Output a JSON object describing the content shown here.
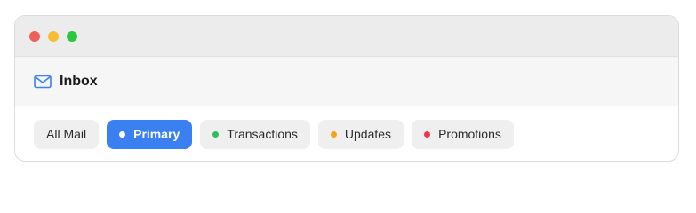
{
  "window": {
    "controls": [
      {
        "name": "close-control",
        "color": "#ee5f57"
      },
      {
        "name": "minimize-control",
        "color": "#f5bd2f"
      },
      {
        "name": "maximize-control",
        "color": "#2ec840"
      }
    ]
  },
  "header": {
    "icon": "mail-icon",
    "title": "Inbox",
    "accent": "#3a80f0"
  },
  "tabs": [
    {
      "label": "All Mail",
      "dot_color": null,
      "active": false
    },
    {
      "label": "Primary",
      "dot_color": "#ffffff",
      "active": true
    },
    {
      "label": "Transactions",
      "dot_color": "#2cc05a",
      "active": false
    },
    {
      "label": "Updates",
      "dot_color": "#f4a21a",
      "active": false
    },
    {
      "label": "Promotions",
      "dot_color": "#e53850",
      "active": false
    }
  ]
}
